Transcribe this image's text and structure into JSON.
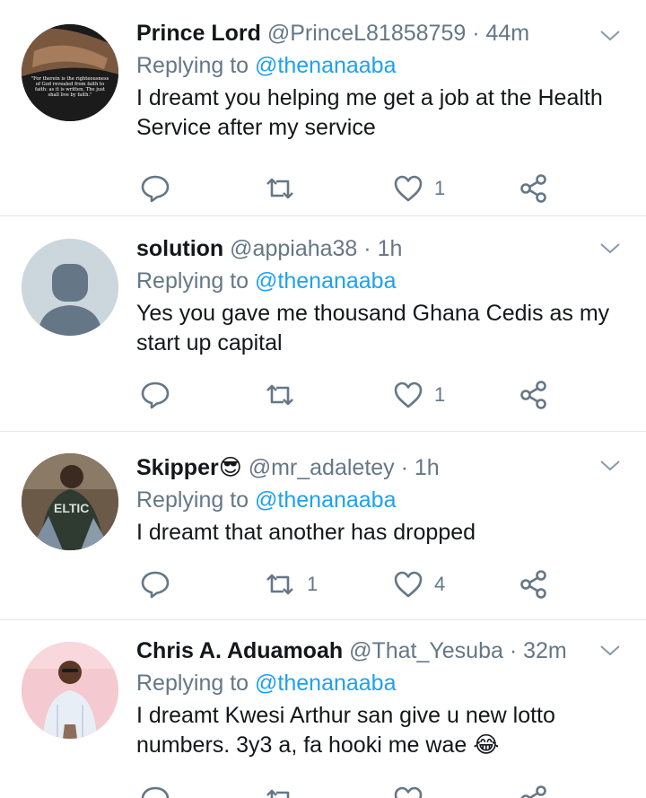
{
  "colors": {
    "link": "#1da1f2",
    "muted": "#657786",
    "text": "#14171a",
    "divider": "#e1e8ed"
  },
  "tweets": [
    {
      "name": "Prince Lord",
      "handle": "@PrinceL81858759",
      "sep": "·",
      "time": "44m",
      "replying_prefix": "Replying to",
      "replying_to": "@thenanaaba",
      "text": "I dreamt you helping me get a job at the Health Service after my service",
      "replies": "",
      "retweets": "",
      "likes": "1",
      "avatar_text": "\"For therein is the righteousness of God revealed from faith to faith: as it is written, The just shall live by faith.\""
    },
    {
      "name": "solution",
      "handle": "@appiaha38",
      "sep": "·",
      "time": "1h",
      "replying_prefix": "Replying to",
      "replying_to": "@thenanaaba",
      "text": "Yes you gave me thousand Ghana Cedis as my start up capital",
      "replies": "",
      "retweets": "",
      "likes": "1"
    },
    {
      "name": "Skipper😎",
      "handle": "@mr_adaletey",
      "sep": "·",
      "time": "1h",
      "replying_prefix": "Replying to",
      "replying_to": "@thenanaaba",
      "text": "I dreamt that another has dropped",
      "replies": "",
      "retweets": "1",
      "likes": "4",
      "avatar_text": "ELTIC"
    },
    {
      "name": "Chris A. Aduamoah",
      "handle": "@That_Yesuba",
      "sep": "·",
      "time": "32m",
      "replying_prefix": "Replying to",
      "replying_to": "@thenanaaba",
      "text": "I dreamt Kwesi Arthur san give u new lotto numbers. 3y3 a, fa hooki me wae 😂",
      "replies": "",
      "retweets": "",
      "likes": ""
    }
  ]
}
